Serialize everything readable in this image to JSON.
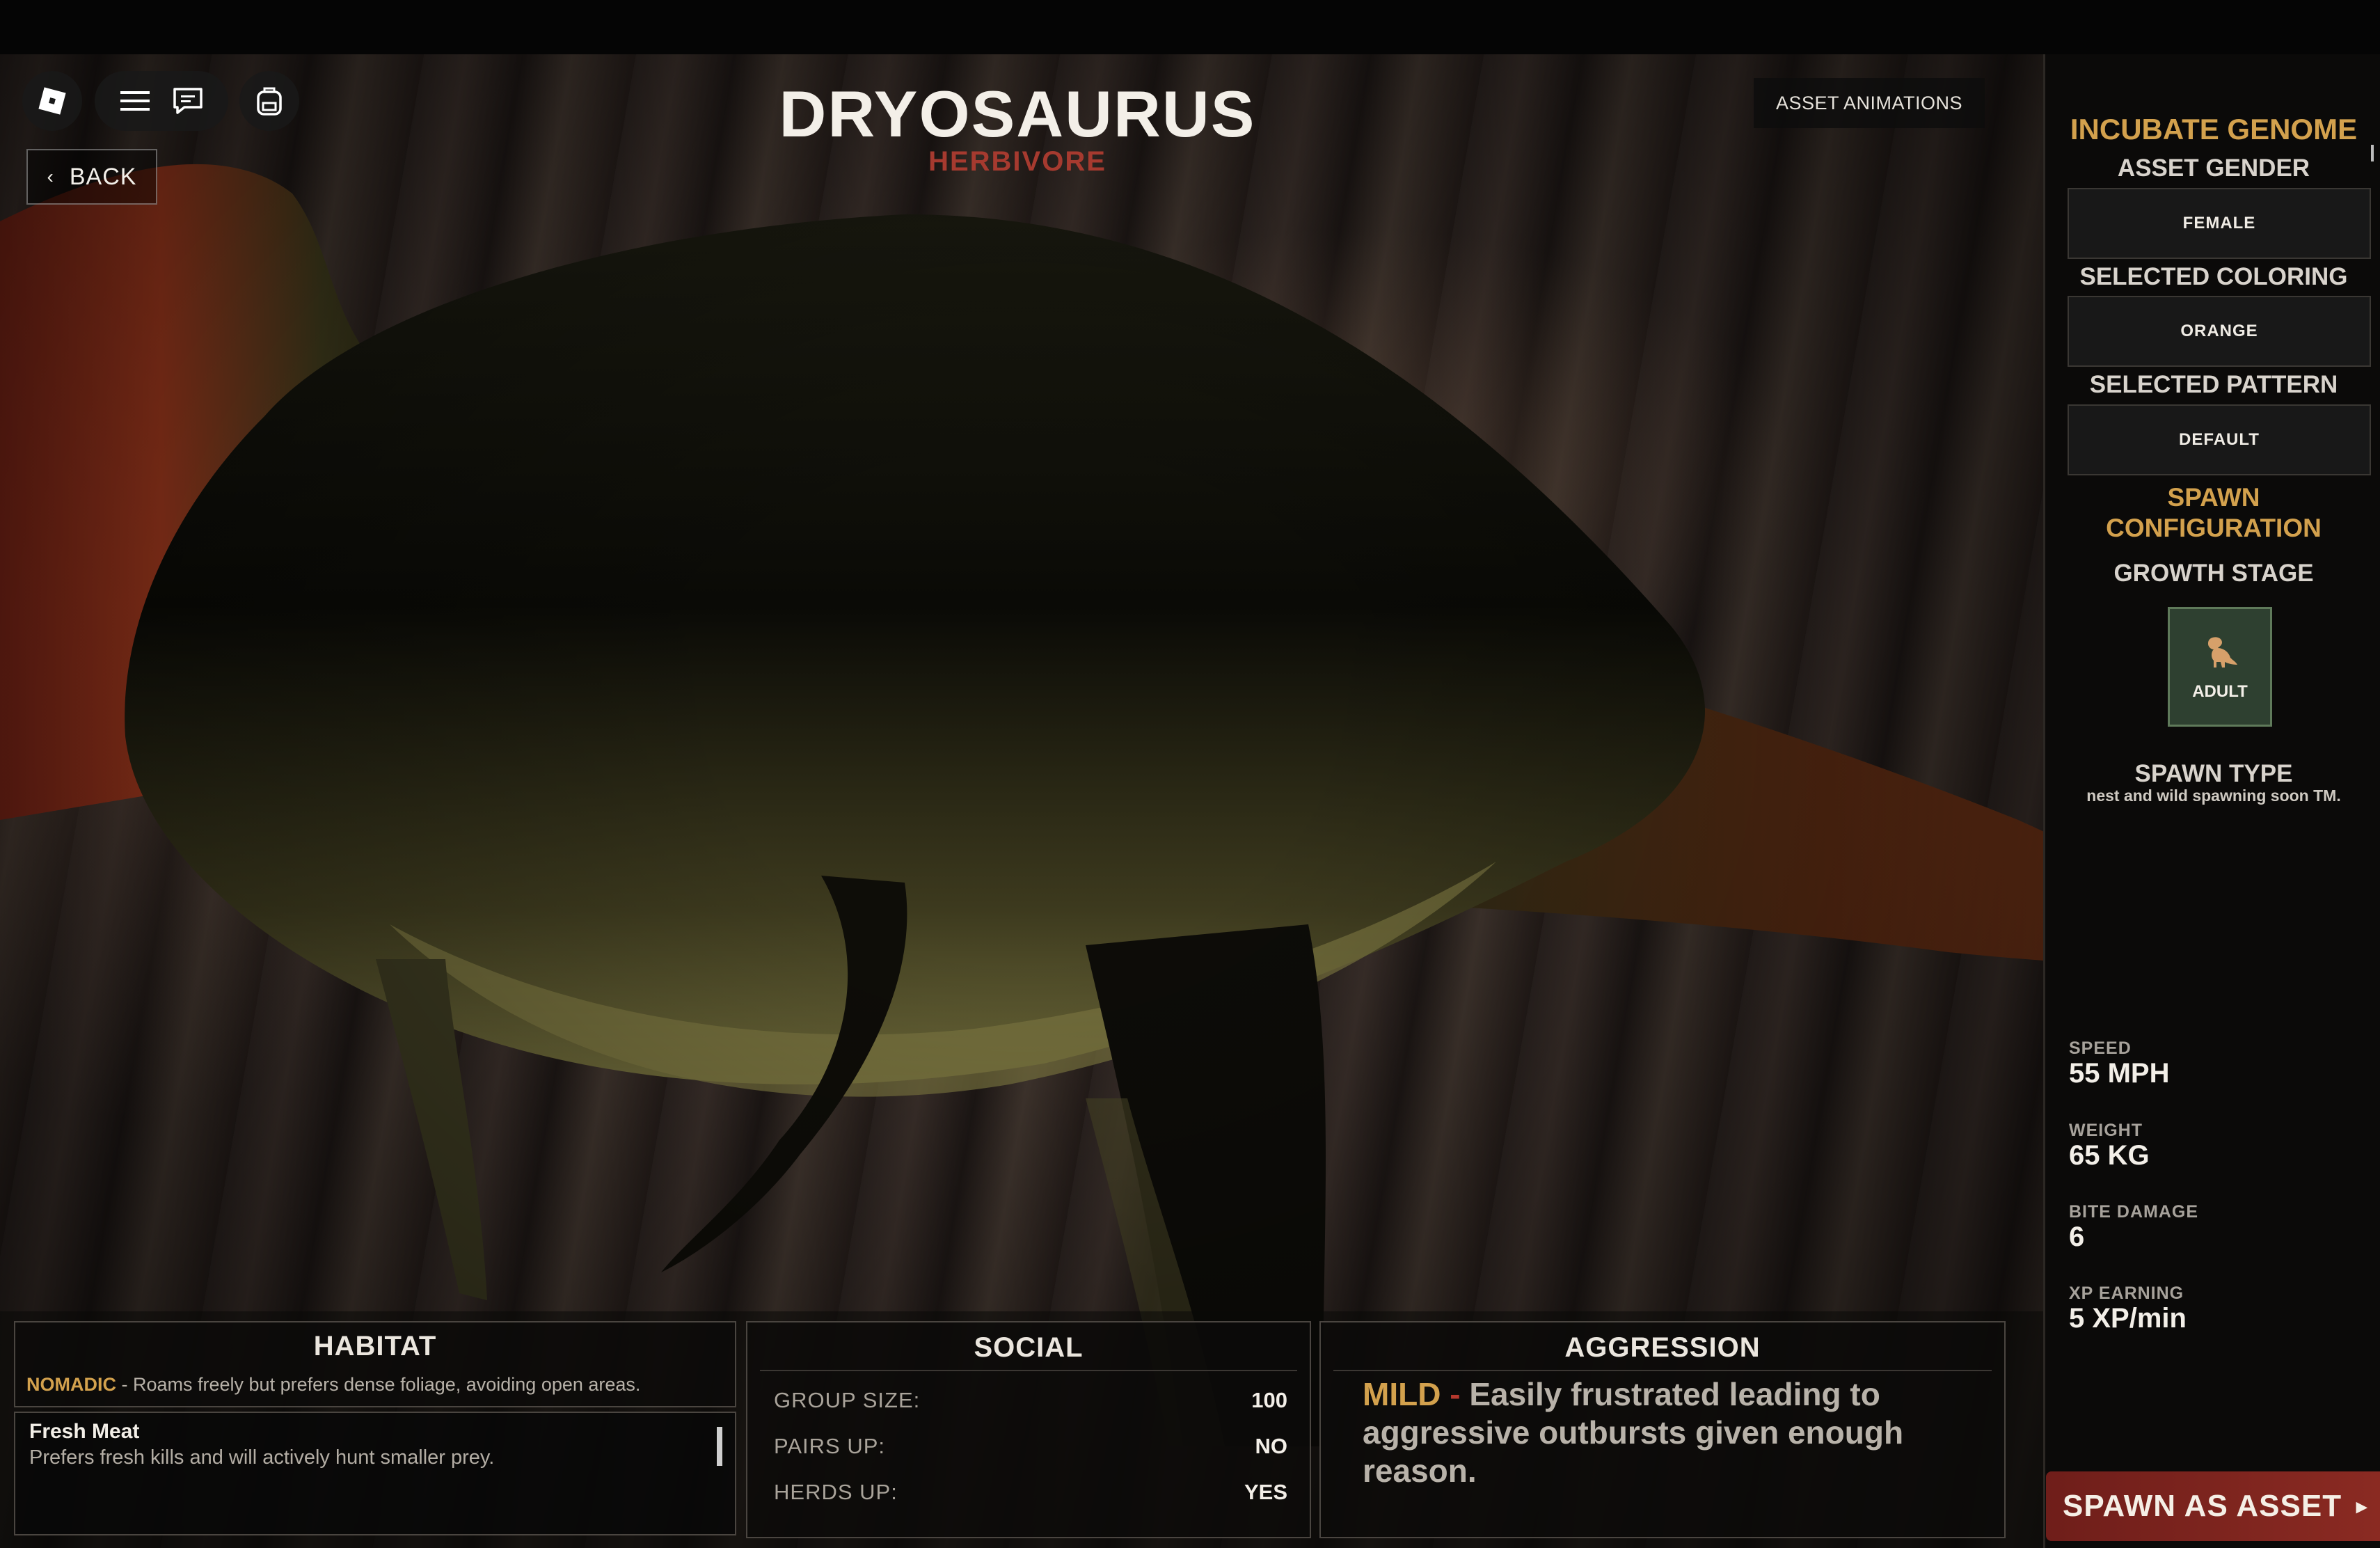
{
  "toolbar": {
    "logo_icon": "roblox-logo-icon",
    "menu_icon": "hamburger-menu-icon",
    "chat_icon": "chat-icon",
    "backpack_icon": "backpack-icon"
  },
  "back": {
    "label": "BACK",
    "icon": "chevron-left-icon"
  },
  "header": {
    "title": "DRYOSAURUS",
    "diet": "HERBIVORE"
  },
  "asset_animations": {
    "label": "ASSET ANIMATIONS"
  },
  "sidebar": {
    "heading": "INCUBATE GENOME",
    "gender": {
      "label": "ASSET GENDER",
      "value": "FEMALE"
    },
    "coloring": {
      "label": "SELECTED COLORING",
      "value": "ORANGE"
    },
    "pattern": {
      "label": "SELECTED PATTERN",
      "value": "DEFAULT"
    },
    "spawn_config": {
      "line1": "SPAWN",
      "line2": "CONFIGURATION"
    },
    "growth": {
      "label": "GROWTH STAGE",
      "stage": "ADULT",
      "icon": "dinosaur-icon"
    },
    "spawn_type": {
      "label": "SPAWN TYPE",
      "note": "nest and wild spawning soon TM."
    },
    "stats": [
      {
        "label": "SPEED",
        "value": "55 MPH"
      },
      {
        "label": "WEIGHT",
        "value": "65 KG"
      },
      {
        "label": "BITE DAMAGE",
        "value": "6"
      },
      {
        "label": "XP EARNING",
        "value": "5 XP/min"
      }
    ]
  },
  "spawn_button": {
    "label": "SPAWN AS ASSET",
    "arrow": "▸"
  },
  "habitat": {
    "title": "HABITAT",
    "keyword": "NOMADIC",
    "description": " - Roams freely but prefers dense foliage, avoiding open areas.",
    "food": {
      "name": "Fresh Meat",
      "description": "Prefers fresh kills and will actively hunt smaller prey."
    }
  },
  "social": {
    "title": "SOCIAL",
    "rows": [
      {
        "key": "GROUP SIZE:",
        "value": "100"
      },
      {
        "key": "PAIRS UP:",
        "value": "NO"
      },
      {
        "key": "HERDS UP:",
        "value": "YES"
      }
    ]
  },
  "aggression": {
    "title": "AGGRESSION",
    "level": "MILD",
    "dash": " - ",
    "description": "Easily frustrated leading to aggressive outbursts given enough reason."
  },
  "colors": {
    "gold": "#d3a14d",
    "herbivore_red": "#a63a2f",
    "spawn_red": "#8a2a22",
    "stage_green": "#2e4030"
  }
}
